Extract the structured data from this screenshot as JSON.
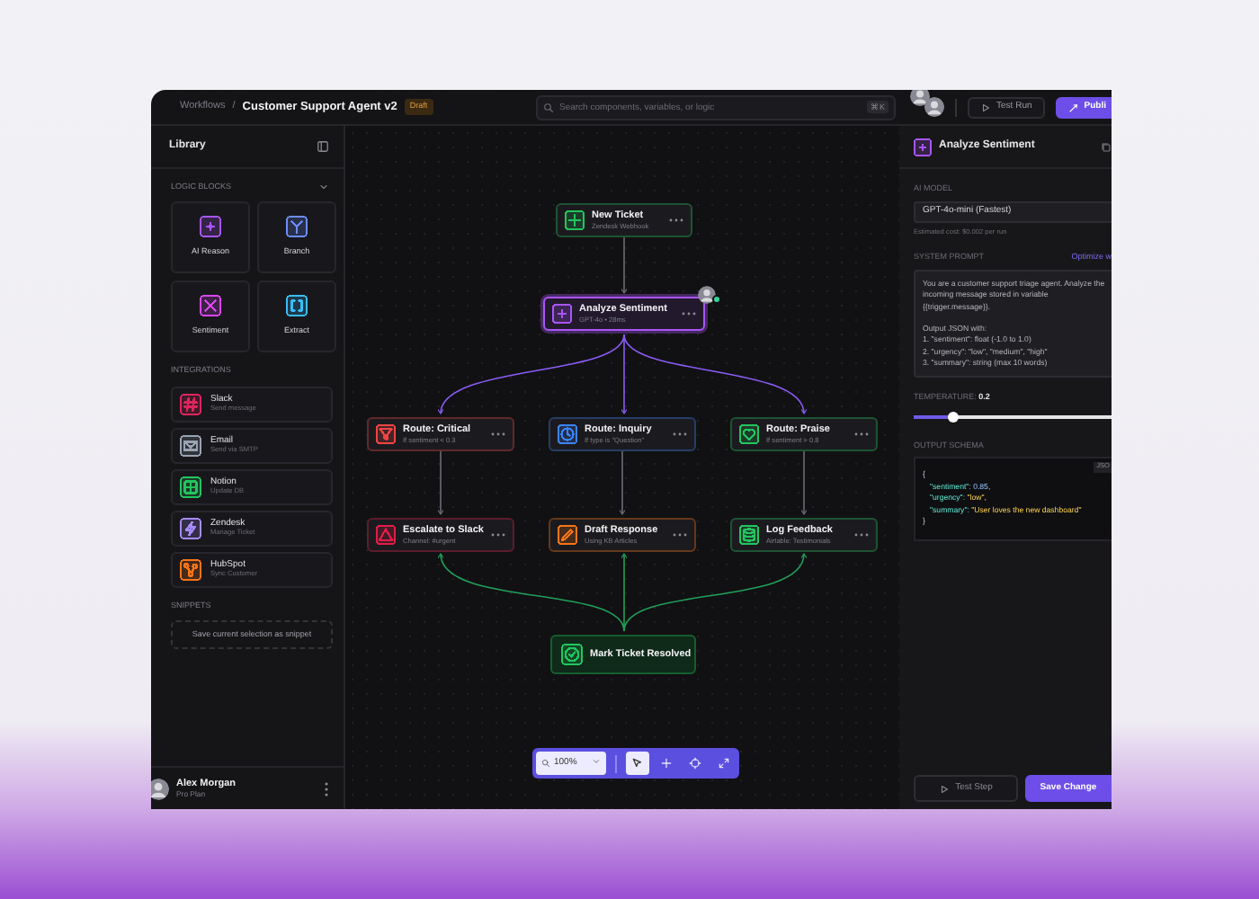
{
  "header": {
    "breadcrumb": "Workflows",
    "separator": "/",
    "title": "Customer Support Agent v2",
    "badge": "Draft"
  },
  "search": {
    "placeholder": "Search components, variables, or logic",
    "shortcut": "⌘K"
  },
  "actions": [
    {
      "label": "Test Run",
      "kind": "outline"
    },
    {
      "label": "Publi",
      "kind": "primary"
    }
  ],
  "sidebar": {
    "title": "Library",
    "logic_blocks": {
      "title": "LOGIC BLOCKS",
      "items": [
        {
          "label": "AI Reason",
          "color": "#a855f7"
        },
        {
          "label": "Branch",
          "color": "#6b8cff"
        },
        {
          "label": "Sentiment",
          "color": "#d946ef"
        },
        {
          "label": "Extract",
          "color": "#38bdf8"
        }
      ]
    },
    "integrations": {
      "title": "INTEGRATIONS",
      "items": [
        {
          "label": "Slack",
          "subtitle": "Send message",
          "color": "#e0245e"
        },
        {
          "label": "Email",
          "subtitle": "Send via SMTP",
          "color": "#9aa3b2"
        },
        {
          "label": "Notion",
          "subtitle": "Update DB",
          "color": "#22c55e"
        },
        {
          "label": "Zendesk",
          "subtitle": "Manage Ticket",
          "color": "#a78bfa"
        },
        {
          "label": "HubSpot",
          "subtitle": "Sync Customer",
          "color": "#f97316"
        }
      ]
    },
    "snippets": {
      "title": "SNIPPETS",
      "action": "Save current selection as snippet"
    },
    "user": {
      "name": "Alex Morgan",
      "plan": "Pro Plan"
    }
  },
  "canvas": {
    "nodes": [
      {
        "title": "New Ticket",
        "subtitle": "Zendesk Webhook",
        "color": "#22c55e",
        "kind": "step",
        "selected": false,
        "avatar": false
      },
      {
        "title": "Analyze Sentiment",
        "subtitle": "GPT-4o • 28ms",
        "color": "#a855f7",
        "kind": "step",
        "selected": true,
        "avatar": true
      },
      {
        "title": "Route: Critical",
        "subtitle": "If sentiment < 0.3",
        "color": "#ef4444",
        "kind": "step",
        "selected": false,
        "avatar": false
      },
      {
        "title": "Route: Inquiry",
        "subtitle": "If type is \"Question\"",
        "color": "#3b82f6",
        "kind": "step",
        "selected": false,
        "avatar": false
      },
      {
        "title": "Route: Praise",
        "subtitle": "If sentiment > 0.8",
        "color": "#22c55e",
        "kind": "step",
        "selected": false,
        "avatar": false
      },
      {
        "title": "Escalate to Slack",
        "subtitle": "Channel: #urgent",
        "color": "#e11d48",
        "kind": "step",
        "selected": false,
        "avatar": false
      },
      {
        "title": "Draft Response",
        "subtitle": "Using KB Articles",
        "color": "#f97316",
        "kind": "step",
        "selected": false,
        "avatar": false
      },
      {
        "title": "Log Feedback",
        "subtitle": "Airtable: Testimonials",
        "color": "#22c55e",
        "kind": "step",
        "selected": false,
        "avatar": false
      },
      {
        "title": "Mark Ticket Resolved",
        "color": "#22c55e",
        "kind": "end",
        "selected": false,
        "avatar": false
      }
    ],
    "zoom": "100%",
    "tools": [
      {
        "selected": true
      },
      {
        "selected": false
      },
      {
        "selected": false
      },
      {
        "selected": false
      }
    ]
  },
  "inspector": {
    "title": "Analyze Sentiment",
    "model_label": "AI MODEL",
    "model": "GPT-4o-mini (Fastest)",
    "cost": "Estimated cost: $0.002 per run",
    "prompt_label": "SYSTEM PROMPT",
    "prompt_action": "Optimize w",
    "prompt": "You are a customer support triage agent. Analyze the\nincoming message stored in variable\n{{trigger.message}}.\n\nOutput JSON with:\n1. \"sentiment\": float (-1.0 to 1.0)\n2. \"urgency\": \"low\", \"medium\", \"high\"\n3. \"summary\": string (max 10 words)",
    "temperature": {
      "label": "TEMPERATURE:",
      "value": "0.2",
      "level": 0.2
    },
    "schema_label": "OUTPUT SCHEMA",
    "schema_tag": "JSO",
    "schema_lines": [
      {
        "kind": "brace",
        "text": "{"
      },
      {
        "kind": "number",
        "key": "\"sentiment\":",
        "value": "0.85,"
      },
      {
        "kind": "string",
        "key": "\"urgency\":",
        "value": "\"low\","
      },
      {
        "kind": "string",
        "key": "\"summary\":",
        "value": "\"User loves the new dashboard\""
      },
      {
        "kind": "brace",
        "text": "}"
      }
    ],
    "buttons": [
      {
        "label": "Test Step",
        "kind": "outline"
      },
      {
        "label": "Save Change",
        "kind": "primary"
      }
    ]
  }
}
